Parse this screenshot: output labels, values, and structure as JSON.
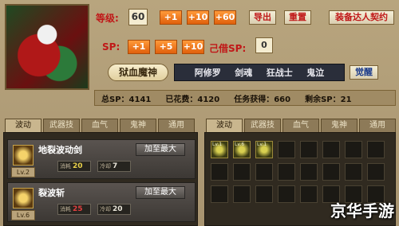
{
  "level": {
    "label": "等级:",
    "value": "60",
    "buttons": [
      "+1",
      "+10",
      "+60"
    ]
  },
  "top_actions": {
    "export": "导出",
    "reset": "重置",
    "master": "装备达人契约"
  },
  "sp": {
    "label": "SP:",
    "buttons": [
      "+1",
      "+5",
      "+10"
    ],
    "borrowed_label": "己借SP:",
    "borrowed_value": "0"
  },
  "title_badge": "狱血魔神",
  "souls": [
    "阿修罗",
    "剑魂",
    "狂战士",
    "鬼泣"
  ],
  "awaken_button": "觉醒",
  "stats": {
    "total_sp": "总SP：4141",
    "spent": "已花费：4120",
    "quest": "任务获得：660",
    "remaining": "剩余SP：21"
  },
  "left_tabs": [
    "波动",
    "武器技",
    "血气",
    "鬼神",
    "通用"
  ],
  "right_tabs": [
    "波动",
    "武器技",
    "血气",
    "鬼神",
    "通用"
  ],
  "skills": [
    {
      "name": "地裂波动剑",
      "level_badge": "Lv.2",
      "max_button": "加至最大",
      "cost_tag": "消耗",
      "cost": "20",
      "cd_tag": "冷却",
      "cd": "7"
    },
    {
      "name": "裂波斩",
      "level_badge": "Lv.6",
      "max_button": "加至最大",
      "cost_tag": "消耗",
      "cost": "25",
      "cd_tag": "冷却",
      "cd": "20"
    }
  ],
  "slots": [
    {
      "badge": "Lv.1"
    },
    {
      "badge": "Lv.6"
    },
    {
      "badge": "Lv.1"
    }
  ],
  "watermark": "京华手游",
  "colors": {
    "accent": "#e0600c",
    "label_red": "#c01818",
    "panel_dark": "#302a20"
  }
}
